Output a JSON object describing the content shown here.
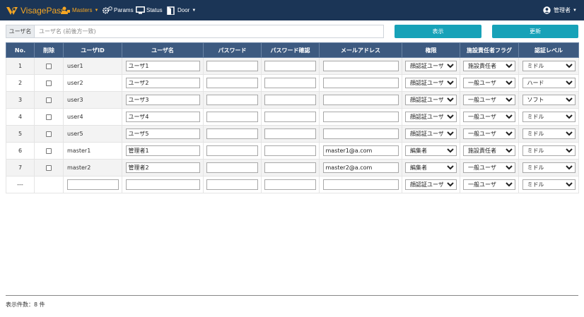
{
  "app": {
    "name": "VisagePass"
  },
  "nav": {
    "masters": "Masters",
    "params": "Params",
    "status": "Status",
    "door": "Door",
    "user": "管理者"
  },
  "search": {
    "label": "ユーザ名",
    "placeholder": "ユーザ名 (前後方一致)",
    "value": ""
  },
  "buttons": {
    "show": "表示",
    "update": "更新"
  },
  "columns": [
    "No.",
    "削除",
    "ユーザID",
    "ユーザ名",
    "パスワード",
    "パスワード確認",
    "メールアドレス",
    "権限",
    "施設責任者フラグ",
    "認証レベル"
  ],
  "rows": [
    {
      "no": "1",
      "user_id": "user1",
      "user_name": "ユーザ1",
      "password": "",
      "password_confirm": "",
      "email": "",
      "role": "顔認証ユーザ",
      "flag": "施設責任者",
      "auth_level": "ミドル"
    },
    {
      "no": "2",
      "user_id": "user2",
      "user_name": "ユーザ2",
      "password": "",
      "password_confirm": "",
      "email": "",
      "role": "顔認証ユーザ",
      "flag": "一般ユーザ",
      "auth_level": "ハード"
    },
    {
      "no": "3",
      "user_id": "user3",
      "user_name": "ユーザ3",
      "password": "",
      "password_confirm": "",
      "email": "",
      "role": "顔認証ユーザ",
      "flag": "一般ユーザ",
      "auth_level": "ソフト"
    },
    {
      "no": "4",
      "user_id": "user4",
      "user_name": "ユーザ4",
      "password": "",
      "password_confirm": "",
      "email": "",
      "role": "顔認証ユーザ",
      "flag": "一般ユーザ",
      "auth_level": "ミドル"
    },
    {
      "no": "5",
      "user_id": "user5",
      "user_name": "ユーザ5",
      "password": "",
      "password_confirm": "",
      "email": "",
      "role": "顔認証ユーザ",
      "flag": "一般ユーザ",
      "auth_level": "ミドル"
    },
    {
      "no": "6",
      "user_id": "master1",
      "user_name": "管理者1",
      "password": "",
      "password_confirm": "",
      "email": "master1@a.com",
      "role": "編集者",
      "flag": "施設責任者",
      "auth_level": "ミドル"
    },
    {
      "no": "7",
      "user_id": "master2",
      "user_name": "管理者2",
      "password": "",
      "password_confirm": "",
      "email": "master2@a.com",
      "role": "編集者",
      "flag": "一般ユーザ",
      "auth_level": "ミドル"
    }
  ],
  "new_row": {
    "no": "---",
    "user_id": "",
    "user_name": "",
    "password": "",
    "password_confirm": "",
    "email": "",
    "role": "顔認証ユーザ",
    "flag": "一般ユーザ",
    "auth_level": "ミドル"
  },
  "footer": {
    "count_text": "表示件数：8 件"
  },
  "colors": {
    "navbar": "#1b3556",
    "accent": "#f5a623",
    "button": "#17a2b8",
    "table_header": "#3d5a80"
  }
}
